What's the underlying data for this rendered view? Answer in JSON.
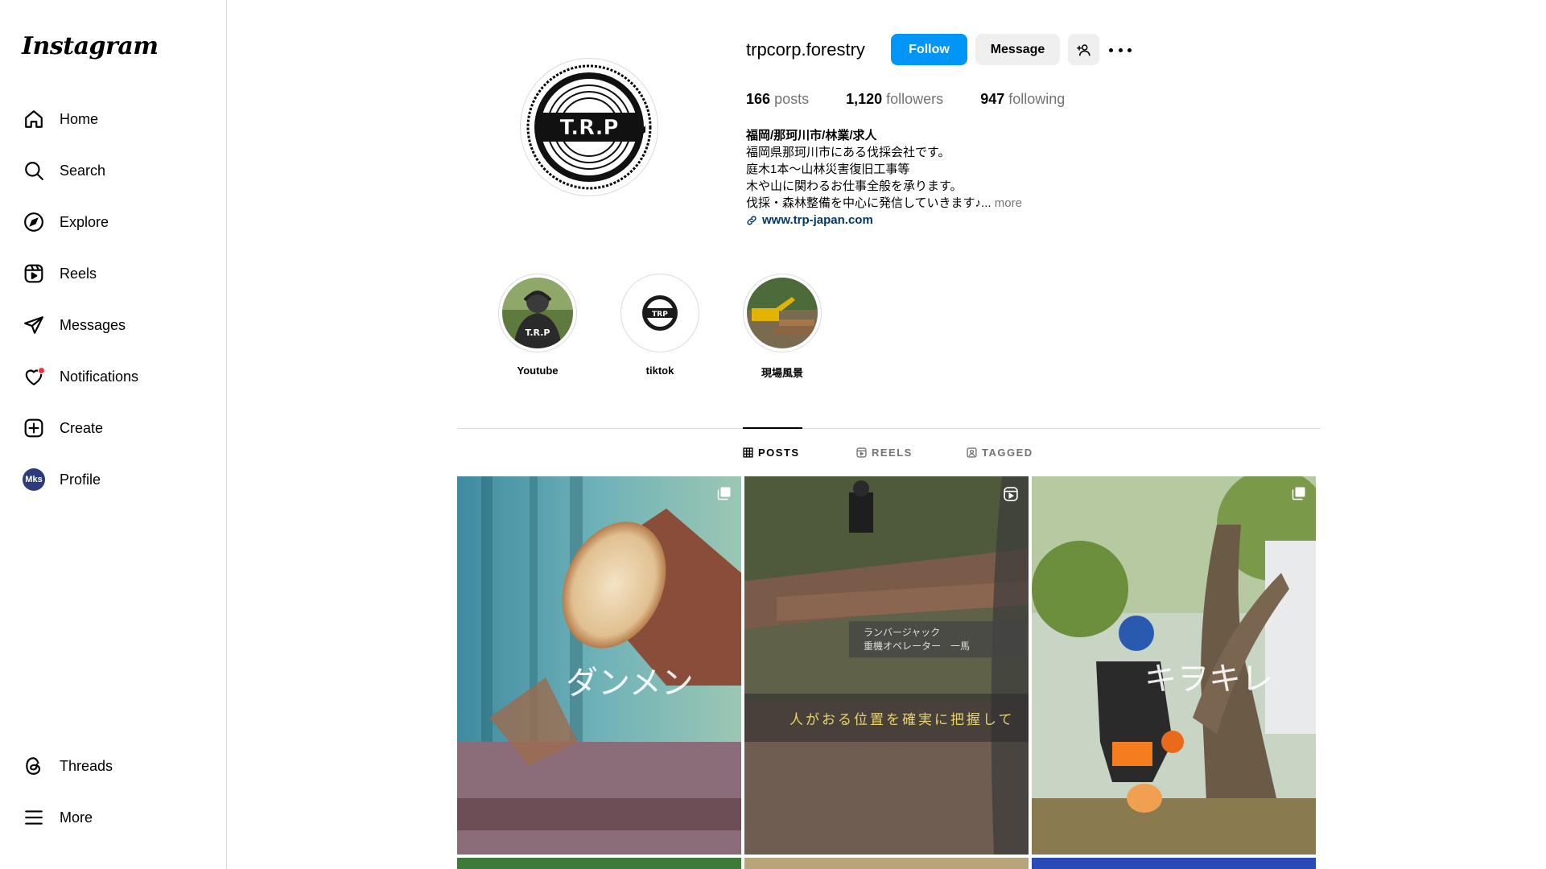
{
  "brand": {
    "logo": "Instagram"
  },
  "nav": [
    {
      "label": "Home",
      "icon": "home-icon"
    },
    {
      "label": "Search",
      "icon": "search-icon"
    },
    {
      "label": "Explore",
      "icon": "explore-icon"
    },
    {
      "label": "Reels",
      "icon": "reels-icon"
    },
    {
      "label": "Messages",
      "icon": "messages-icon"
    },
    {
      "label": "Notifications",
      "icon": "heart-icon"
    },
    {
      "label": "Create",
      "icon": "create-icon"
    },
    {
      "label": "Profile",
      "icon": "avatar"
    }
  ],
  "nav_bottom": [
    {
      "label": "Threads",
      "icon": "threads-icon"
    },
    {
      "label": "More",
      "icon": "menu-icon"
    }
  ],
  "profile": {
    "username": "trpcorp.forestry",
    "follow_label": "Follow",
    "message_label": "Message",
    "avatar_initials": "Mks",
    "logo_text": "T.R.P",
    "stats": {
      "posts_count": "166",
      "posts_label": "posts",
      "followers_count": "1,120",
      "followers_label": "followers",
      "following_count": "947",
      "following_label": "following"
    },
    "bio": {
      "name": "福岡/那珂川市/林業/求人",
      "lines": [
        "福岡県那珂川市にある伐採会社です。",
        "庭木1本〜山林災害復旧工事等",
        "木や山に関わるお仕事全般を承ります。",
        "伐採・森林整備を中心に発信していきます♪..."
      ],
      "more": "more",
      "link": "www.trp-japan.com"
    }
  },
  "highlights": [
    {
      "label": "Youtube"
    },
    {
      "label": "tiktok"
    },
    {
      "label": "現場風景"
    }
  ],
  "tabs": [
    {
      "label": "POSTS",
      "icon": "grid-icon",
      "active": true
    },
    {
      "label": "REELS",
      "icon": "reels-icon",
      "active": false
    },
    {
      "label": "TAGGED",
      "icon": "tagged-icon",
      "active": false
    }
  ],
  "posts": [
    {
      "type": "carousel",
      "overlay": "ダンメン"
    },
    {
      "type": "reel",
      "overlay_box_line1": "ランバージャック",
      "overlay_box_line2": "重機オペレーター　一馬",
      "overlay_caption": "人がおる位置を確実に把握して"
    },
    {
      "type": "carousel",
      "overlay": "キヲキレ"
    }
  ]
}
